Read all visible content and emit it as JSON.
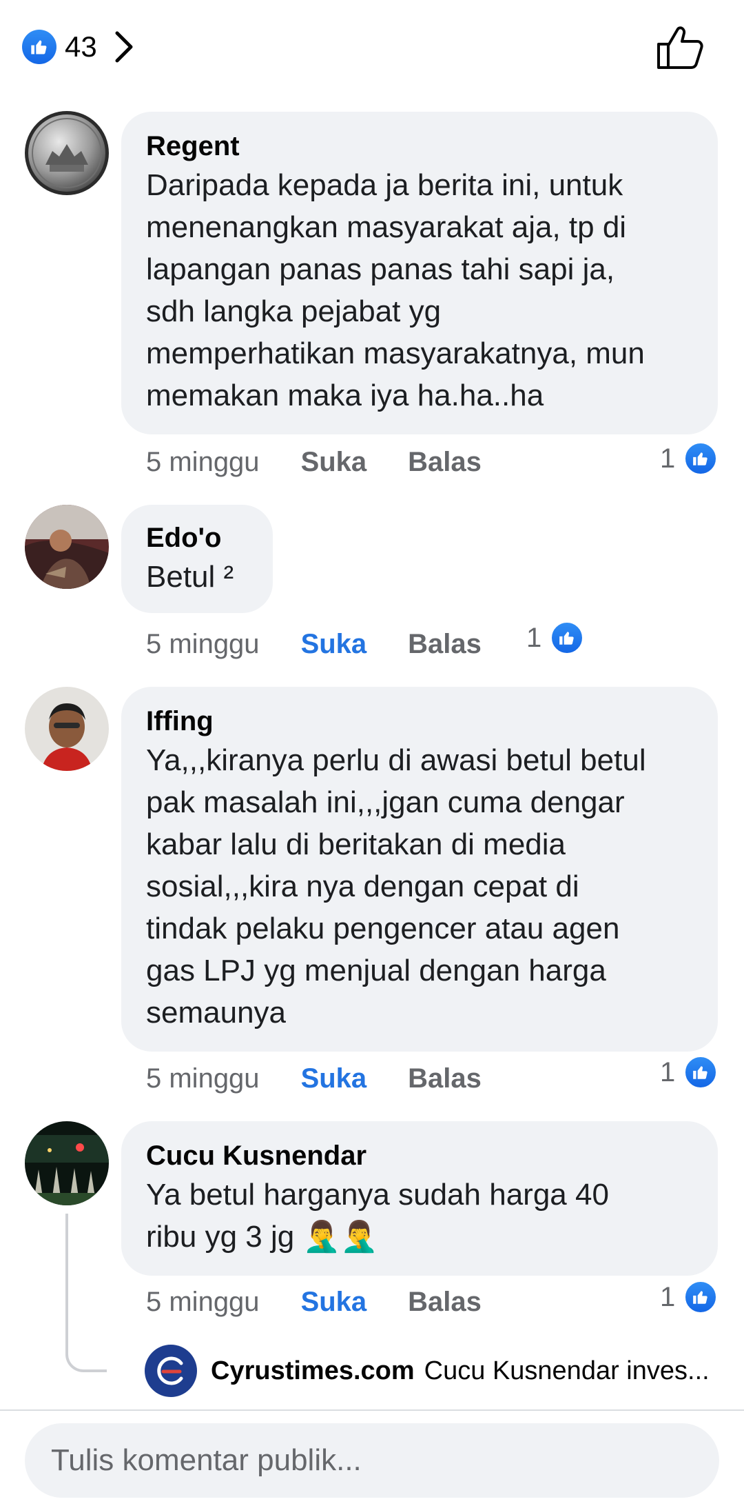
{
  "header": {
    "reaction_count": "43",
    "icons": {
      "reaction": "like-icon",
      "expand": "chevron-right-icon",
      "like_action": "thumbs-up-outline-icon"
    }
  },
  "colors": {
    "accent": "#2374e1",
    "bubble": "#f0f2f5",
    "meta": "#65676b"
  },
  "comments": [
    {
      "author": "Regent",
      "text": "Daripada kepada ja berita ini, untuk\nmenenangkan masyarakat aja, tp di\nlapangan panas panas tahi sapi ja,\nsdh langka pejabat yg\nmemperhatikan masyarakatnya, mun\nmemakan maka iya ha.ha..ha",
      "time": "5 minggu",
      "like_label": "Suka",
      "reply_label": "Balas",
      "reactions": "1",
      "liked": false
    },
    {
      "author": "Edo'o",
      "text": "Betul ²",
      "time": "5 minggu",
      "like_label": "Suka",
      "reply_label": "Balas",
      "reactions": "1",
      "liked": true
    },
    {
      "author": "Iffing",
      "text": "Ya,,,kiranya perlu di awasi betul betul\npak masalah ini,,,jgan cuma dengar\nkabar lalu di beritakan di media\nsosial,,,kira nya dengan cepat di\ntindak pelaku pengencer atau agen\ngas LPJ yg menjual dengan harga\nsemaunya",
      "time": "5 minggu",
      "like_label": "Suka",
      "reply_label": "Balas",
      "reactions": "1",
      "liked": true
    },
    {
      "author": "Cucu Kusnendar",
      "text": "Ya betul harganya sudah harga 40\nribu yg 3 jg 🤦‍♂️🤦‍♂️",
      "time": "5 minggu",
      "like_label": "Suka",
      "reply_label": "Balas",
      "reactions": "1",
      "liked": true
    }
  ],
  "reply_preview": {
    "name": "Cyrustimes.com",
    "text": "Cucu Kusnendar inves..."
  },
  "composer": {
    "placeholder": "Tulis komentar publik..."
  }
}
